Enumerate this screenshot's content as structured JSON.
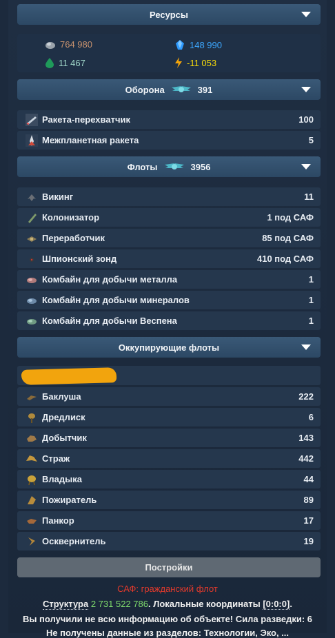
{
  "resources": {
    "header": "Ресурсы",
    "metal": "764 980",
    "crystal": "148 990",
    "vespene": "11 467",
    "energy": "-11 053",
    "colors": {
      "metal": "#c8926e",
      "crystal": "#3da8ff",
      "vespene": "#9fd6c8",
      "energy": "#f5d90a"
    }
  },
  "defense": {
    "header": "Оборона",
    "count": "391",
    "items": [
      {
        "label": "Ракета-перехватчик",
        "value": "100",
        "icon": "interceptor-rocket-icon"
      },
      {
        "label": "Межпланетная ракета",
        "value": "5",
        "icon": "interplanetary-rocket-icon"
      }
    ]
  },
  "fleets": {
    "header": "Флоты",
    "count": "3956",
    "items": [
      {
        "label": "Викинг",
        "value": "11",
        "icon": "viking-icon"
      },
      {
        "label": "Колонизатор",
        "value": "1 под САФ",
        "icon": "colonizer-icon"
      },
      {
        "label": "Переработчик",
        "value": "85 под САФ",
        "icon": "recycler-icon"
      },
      {
        "label": "Шпионский зонд",
        "value": "410 под САФ",
        "icon": "spy-probe-icon"
      },
      {
        "label": "Комбайн для добычи металла",
        "value": "1",
        "icon": "metal-harvester-icon"
      },
      {
        "label": "Комбайн для добычи минералов",
        "value": "1",
        "icon": "mineral-harvester-icon"
      },
      {
        "label": "Комбайн для добычи Веспена",
        "value": "1",
        "icon": "vespene-harvester-icon"
      }
    ]
  },
  "occupying": {
    "header": "Оккупирующие флоты",
    "items": [
      {
        "label": "Баклуша",
        "value": "222",
        "icon": "zergling-icon"
      },
      {
        "label": "Дредлиск",
        "value": "6",
        "icon": "dredlisk-icon"
      },
      {
        "label": "Добытчик",
        "value": "143",
        "icon": "harvester-icon"
      },
      {
        "label": "Страж",
        "value": "442",
        "icon": "guardian-icon"
      },
      {
        "label": "Владыка",
        "value": "44",
        "icon": "overlord-icon"
      },
      {
        "label": "Пожиратель",
        "value": "89",
        "icon": "devourer-icon"
      },
      {
        "label": "Панкор",
        "value": "17",
        "icon": "pankor-icon"
      },
      {
        "label": "Осквернитель",
        "value": "19",
        "icon": "defiler-icon"
      }
    ]
  },
  "settings": {
    "label": "Постройки"
  },
  "info": {
    "saf": "САФ: гражданский флот",
    "structure_label": "Структура",
    "structure_value": "2 731 522 786",
    "coords_label": ". Локальные координаты",
    "coords_value": "[0:0:0]",
    "coords_end": ".",
    "incomplete": "Вы получили не всю информацию об объекте! Сила разведки: 6",
    "tech_partial": "Не получены данные из разделов: Технологии, Эко, ..."
  }
}
